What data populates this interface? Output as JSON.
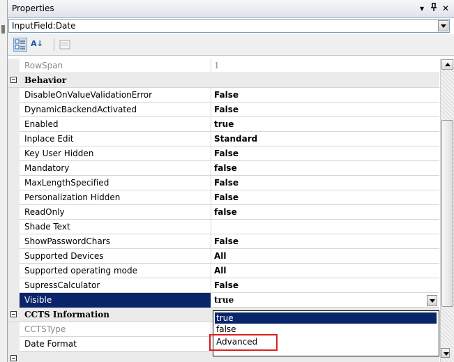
{
  "panel": {
    "title": "Properties",
    "pin_glyph": "▾",
    "dock_glyph": "ꟼ",
    "close_glyph": "✕"
  },
  "object_selector": {
    "value": "InputField:Date"
  },
  "toolbar": {
    "categorized_icon": "categorized-icon",
    "alphabetical_label": "A↓",
    "property_pages_icon": "property-pages-icon"
  },
  "grid": {
    "rowspan": {
      "name": "RowSpan",
      "value": "1"
    },
    "behavior_category": "Behavior",
    "behavior": [
      {
        "name": "DisableOnValueValidationError",
        "value": "False"
      },
      {
        "name": "DynamicBackendActivated",
        "value": "False"
      },
      {
        "name": "Enabled",
        "value": "true"
      },
      {
        "name": "Inplace Edit",
        "value": "Standard"
      },
      {
        "name": "Key User Hidden",
        "value": "False"
      },
      {
        "name": "Mandatory",
        "value": "false"
      },
      {
        "name": "MaxLengthSpecified",
        "value": "False"
      },
      {
        "name": "Personalization Hidden",
        "value": "False"
      },
      {
        "name": "ReadOnly",
        "value": "false"
      },
      {
        "name": "Shade Text",
        "value": ""
      },
      {
        "name": "ShowPasswordChars",
        "value": "False"
      },
      {
        "name": "Supported Devices",
        "value": "All"
      },
      {
        "name": "Supported operating mode",
        "value": "All"
      },
      {
        "name": "SupressCalculator",
        "value": "False"
      }
    ],
    "selected": {
      "name": "Visible",
      "value": "true"
    },
    "ccts_category": "CCTS Information",
    "ccts": [
      {
        "name": "CCTSType",
        "value": ""
      },
      {
        "name": "Date Format",
        "value": ""
      }
    ]
  },
  "dropdown": {
    "options": [
      "true",
      "false",
      "Advanced"
    ],
    "selected_option": "true",
    "highlight_color": "#0a246a",
    "annotation_color": "#e0201f"
  }
}
